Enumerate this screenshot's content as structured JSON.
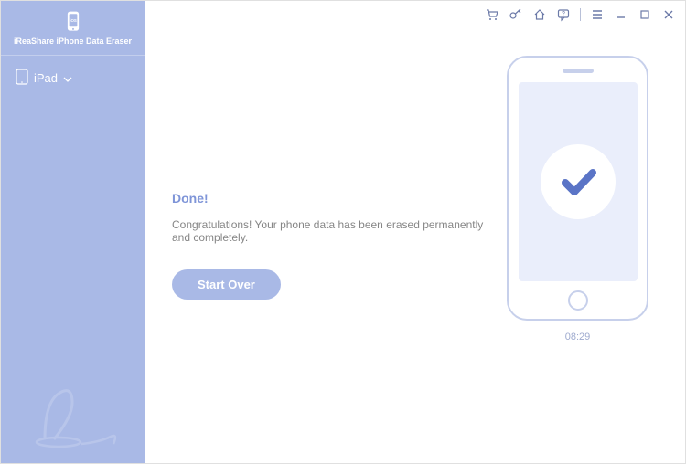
{
  "app": {
    "title": "iReaShare iPhone Data Eraser"
  },
  "sidebar": {
    "device_label": "iPad"
  },
  "content": {
    "heading": "Done!",
    "message": "Congratulations! Your phone data has been erased permanently and completely.",
    "button_label": "Start Over",
    "timestamp": "08:29"
  },
  "colors": {
    "accent": "#a9b9e6",
    "check": "#5a74c6"
  }
}
